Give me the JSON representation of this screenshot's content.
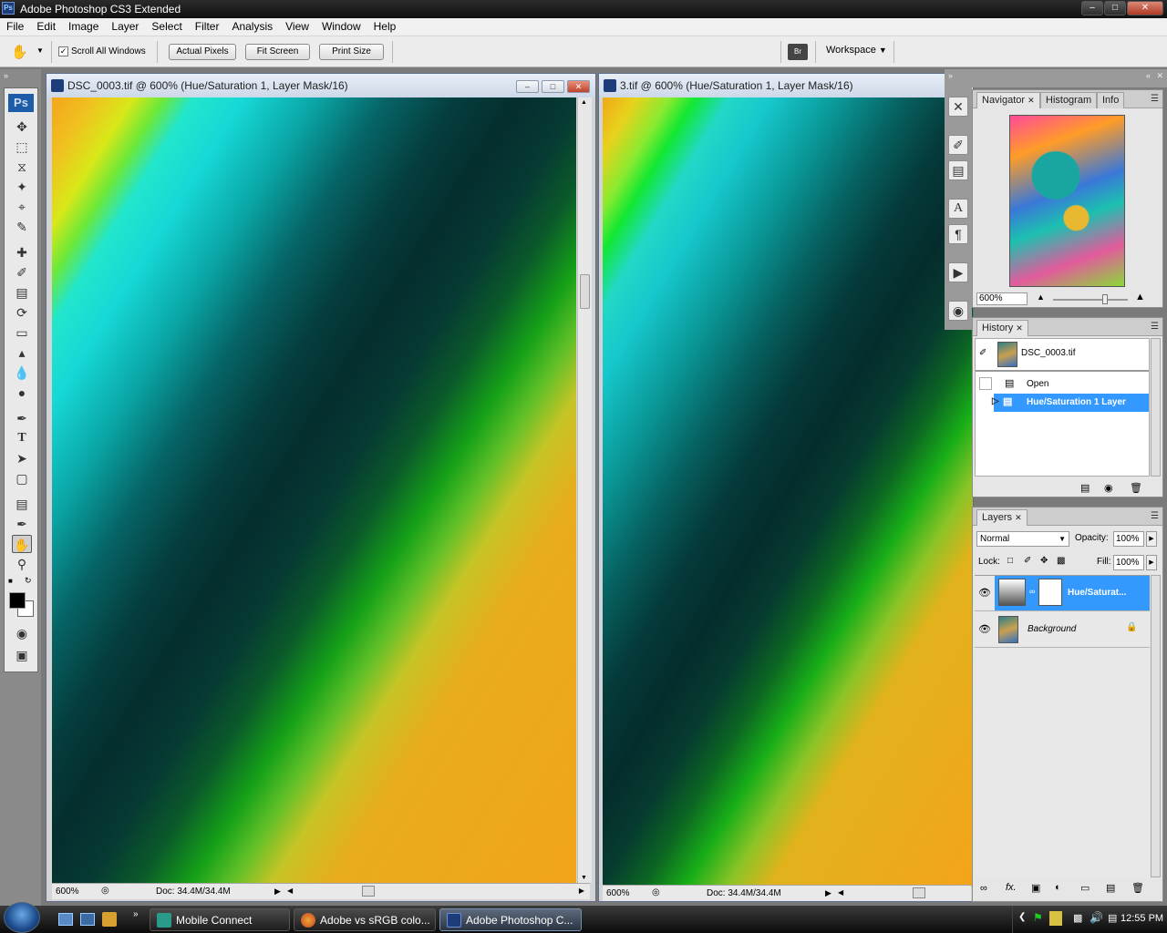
{
  "app": {
    "title": "Adobe Photoshop CS3 Extended",
    "logo": "Ps",
    "window_buttons": [
      "minimize-icon",
      "maximize-icon",
      "close-icon"
    ]
  },
  "menu": [
    "File",
    "Edit",
    "Image",
    "Layer",
    "Select",
    "Filter",
    "Analysis",
    "View",
    "Window",
    "Help"
  ],
  "options": {
    "scroll_all_windows_label": "Scroll All Windows",
    "scroll_all_windows_checked": true,
    "actual_pixels": "Actual Pixels",
    "fit_screen": "Fit Screen",
    "print_size": "Print Size",
    "workspace": "Workspace"
  },
  "tools": {
    "logo": "Ps",
    "items": [
      "move-tool",
      "marquee-tool",
      "lasso-tool",
      "magic-wand-tool",
      "crop-tool",
      "slice-tool",
      "healing-brush-tool",
      "brush-tool",
      "clone-stamp-tool",
      "history-brush-tool",
      "eraser-tool",
      "paint-bucket-tool",
      "blur-tool",
      "dodge-tool",
      "pen-tool",
      "type-tool",
      "path-selection-tool",
      "rectangle-tool",
      "notes-tool",
      "eyedropper-tool",
      "hand-tool",
      "zoom-tool",
      "quick-mask-tool",
      "screen-mode-tool"
    ],
    "active": "hand-tool",
    "foreground_color": "#000000",
    "background_color": "#ffffff"
  },
  "documents": [
    {
      "title": "DSC_0003.tif @ 600% (Hue/Saturation 1, Layer Mask/16)",
      "zoom": "600%",
      "doc_info": "Doc: 34.4M/34.4M"
    },
    {
      "title": "3.tif @ 600% (Hue/Saturation 1, Layer Mask/16)",
      "zoom": "600%",
      "doc_info": "Doc: 34.4M/34.4M"
    }
  ],
  "navigator": {
    "tabs": [
      "Navigator",
      "Histogram",
      "Info"
    ],
    "zoom": "600%"
  },
  "history": {
    "tab": "History",
    "snapshot": "DSC_0003.tif",
    "items": [
      {
        "label": "Open",
        "selected": false
      },
      {
        "label": "Hue/Saturation 1 Layer",
        "selected": true
      }
    ]
  },
  "layers": {
    "tab": "Layers",
    "blend_mode": "Normal",
    "opacity_label": "Opacity:",
    "opacity": "100%",
    "lock_label": "Lock:",
    "fill_label": "Fill:",
    "fill": "100%",
    "items": [
      {
        "name": "Hue/Saturat...",
        "selected": true
      },
      {
        "name": "Background",
        "selected": false
      }
    ]
  },
  "taskbar": {
    "items": [
      {
        "label": "Mobile Connect",
        "active": false
      },
      {
        "label": "Adobe vs sRGB colo...",
        "active": false
      },
      {
        "label": "Adobe Photoshop C...",
        "active": true
      }
    ],
    "clock": "12:55 PM"
  },
  "colors": {
    "selection_blue": "#3399ff",
    "accent_green": "#22cc22"
  }
}
